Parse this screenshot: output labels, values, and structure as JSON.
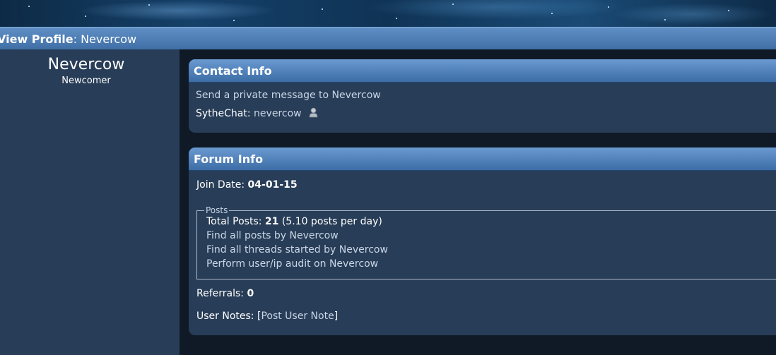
{
  "header": {
    "title_label": "View Profile",
    "title_value": "Nevercow"
  },
  "profile": {
    "username": "Nevercow",
    "rank": "Newcomer"
  },
  "contact": {
    "heading": "Contact Info",
    "pm_link": "Send a private message to Nevercow",
    "chat_label": "SytheChat:",
    "chat_value": "nevercow",
    "chat_icon": "user-icon"
  },
  "forum": {
    "heading": "Forum Info",
    "join_label": "Join Date:",
    "join_value": "04-01-15",
    "posts_legend": "Posts",
    "total_label": "Total Posts:",
    "total_value": "21",
    "per_day": "(5.10 posts per day)",
    "links": [
      "Find all posts by Nevercow",
      "Find all threads started by Nevercow",
      "Perform user/ip audit on Nevercow"
    ],
    "referrals_label": "Referrals:",
    "referrals_value": "0",
    "notes_label": "User Notes:",
    "notes_open": "[",
    "notes_link": "Post User Note",
    "notes_close": "]"
  },
  "colors": {
    "background": "#101a27",
    "panel": "#283d57",
    "header_bar": "#4f7fb8",
    "text": "#e9eef5"
  }
}
